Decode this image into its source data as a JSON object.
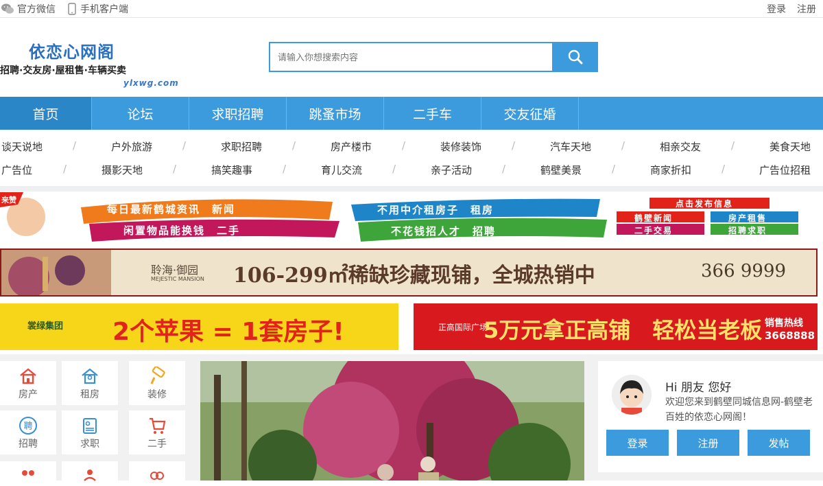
{
  "topbar": {
    "wechat": "官方微信",
    "mobile": "手机客户端",
    "login": "登录",
    "register": "注册"
  },
  "logo": {
    "title": "依恋心网阁",
    "subtitle": "招聘·交友房·屋租售·车辆买卖",
    "url": "ylxwg.com"
  },
  "search": {
    "placeholder": "请输入你想搜索内容"
  },
  "nav": [
    "首页",
    "论坛",
    "求职招聘",
    "跳蚤市场",
    "二手车",
    "交友征婚"
  ],
  "subnav": {
    "row1": [
      "谈天说地",
      "户外旅游",
      "求职招聘",
      "房产楼市",
      "装修装饰",
      "汽车天地",
      "相亲交友",
      "美食天地"
    ],
    "row2": [
      "广告位",
      "摄影天地",
      "搞笑趣事",
      "育儿交流",
      "亲子活动",
      "鹤壁美景",
      "商家折扣",
      "广告位招租"
    ]
  },
  "banner1": {
    "corner": "来赞",
    "line1": "每日最新鹤城资讯　新闻",
    "line2": "闲置物品能换钱　二手",
    "line3": "不用中介租房子　租房",
    "line4": "不花钱招人才　招聘",
    "publish": "点击发布信息",
    "tags": [
      "鹤壁新闻",
      "房产租售",
      "二手交易",
      "招聘求职"
    ]
  },
  "banner2": {
    "brand": "聆海·御园",
    "brand_en": "MEJESTIC MANSION",
    "headline": "106-299㎡稀缺珍藏现铺，全城热销中",
    "phone": "366 9999"
  },
  "banner3": {
    "brand": "裳绿集团",
    "headline": "2个苹果 = 1套房子!"
  },
  "banner4": {
    "brand": "正高国际广场",
    "headline": "5万元拿正高铺　轻松当老板",
    "hotline_label": "销售热线",
    "hotline": "3668888"
  },
  "categories": [
    {
      "label": "房产",
      "icon": "house-icon",
      "color": "#e84a3a"
    },
    {
      "label": "租房",
      "icon": "rent-house-icon",
      "color": "#3a8fd4"
    },
    {
      "label": "装修",
      "icon": "paint-roller-icon",
      "color": "#f2a51d"
    },
    {
      "label": "招聘",
      "icon": "hire-icon",
      "color": "#3a8fd4"
    },
    {
      "label": "求职",
      "icon": "resume-icon",
      "color": "#3a8fd4"
    },
    {
      "label": "二手",
      "icon": "cart-icon",
      "color": "#e84a3a"
    },
    {
      "label": "",
      "icon": "couple-icon",
      "color": "#e84a3a"
    },
    {
      "label": "",
      "icon": "family-icon",
      "color": "#e84a3a"
    },
    {
      "label": "",
      "icon": "gender-icon",
      "color": "#e84a3a"
    }
  ],
  "user": {
    "greeting": "Hi 朋友 您好",
    "welcome": "欢迎您来到鹤壁同城信息网-鹤壁老百姓的依恋心网阁！",
    "login": "登录",
    "register": "注册",
    "post": "发帖"
  },
  "colors": {
    "primary": "#3b9bdc",
    "primary_dark": "#2a86c6"
  }
}
